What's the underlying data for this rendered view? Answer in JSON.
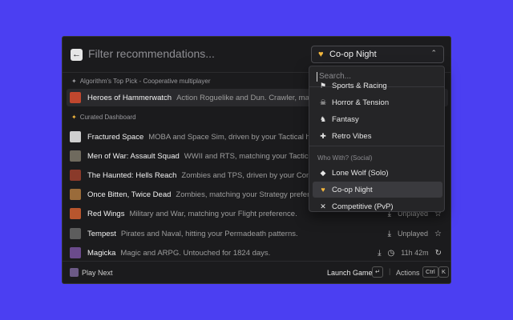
{
  "header": {
    "filter_placeholder": "Filter recommendations...",
    "dropdown_label": "Co-op Night"
  },
  "top_pick": {
    "section_label": "Algorithm's Top Pick - Cooperative multiplayer",
    "title": "Heroes of Hammerwatch",
    "desc": "Action Roguelike and Dun. Crawler, matching your..."
  },
  "curated": {
    "section_label": "Curated Dashboard",
    "rows": [
      {
        "title": "Fractured Space",
        "desc": "MOBA and Space Sim, driven by your Tactical history.",
        "thumb": "#cfcfcf"
      },
      {
        "title": "Men of War: Assault Squad",
        "desc": "WWII and RTS, matching your Tactical play.",
        "thumb": "#6f6a5e"
      },
      {
        "title": "The Haunted: Hells Reach",
        "desc": "Zombies and TPS, driven by your Combat history.",
        "thumb": "#8a3a2a"
      },
      {
        "title": "Once Bitten, Twice Dead",
        "desc": "Zombies, matching your Strategy preference.",
        "thumb": "#9a6b3a"
      },
      {
        "title": "Red Wings",
        "desc": "Military and War, matching your Flight preference.",
        "thumb": "#b8562e",
        "status": "Unplayed"
      },
      {
        "title": "Tempest",
        "desc": "Pirates and Naval, hitting your Permadeath patterns.",
        "thumb": "#5d5d5d",
        "status": "Unplayed"
      },
      {
        "title": "Magicka",
        "desc": "Magic and ARPG. Untouched for 1824 days.",
        "thumb": "#6b4b8c",
        "status": "11h 42m"
      }
    ]
  },
  "menu": {
    "search_placeholder": "Search...",
    "items_top": [
      {
        "label": "Sports & Racing",
        "icon": "racing-icon"
      },
      {
        "label": "Horror & Tension",
        "icon": "ghost-icon"
      },
      {
        "label": "Fantasy",
        "icon": "dragon-icon"
      },
      {
        "label": "Retro Vibes",
        "icon": "joystick-icon"
      }
    ],
    "group_label": "Who With? (Social)",
    "items_social": [
      {
        "label": "Lone Wolf (Solo)",
        "icon": "wolf-icon"
      },
      {
        "label": "Co-op Night",
        "icon": "heart-icon"
      },
      {
        "label": "Competitive (PvP)",
        "icon": "swords-icon"
      }
    ]
  },
  "footer": {
    "play_next": "Play Next",
    "launch": "Launch Game",
    "launch_key": "↵",
    "actions": "Actions",
    "key1": "Ctrl",
    "key2": "K"
  },
  "colors": {
    "background": "#4b3ff2",
    "window": "#1b1b1d",
    "accent_heart": "#f5b83d"
  }
}
